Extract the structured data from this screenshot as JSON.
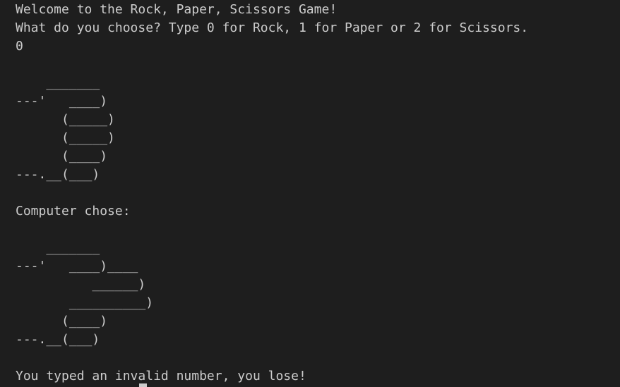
{
  "terminal": {
    "welcome": "Welcome to the Rock, Paper, Scissors Game!",
    "prompt": "What do you choose? Type 0 for Rock, 1 for Paper or 2 for Scissors.",
    "user_input": "0",
    "rock_art": [
      "    _______",
      "---'   ____)",
      "      (_____)",
      "      (_____)",
      "      (____)",
      "---.__(___)"
    ],
    "computer_label": "Computer chose:",
    "scissors_art": [
      "    _______",
      "---'   ____)____",
      "          ______)",
      "       __________)",
      "      (____)",
      "---.__(___)"
    ],
    "result": "You typed an invalid number, you lose!"
  }
}
